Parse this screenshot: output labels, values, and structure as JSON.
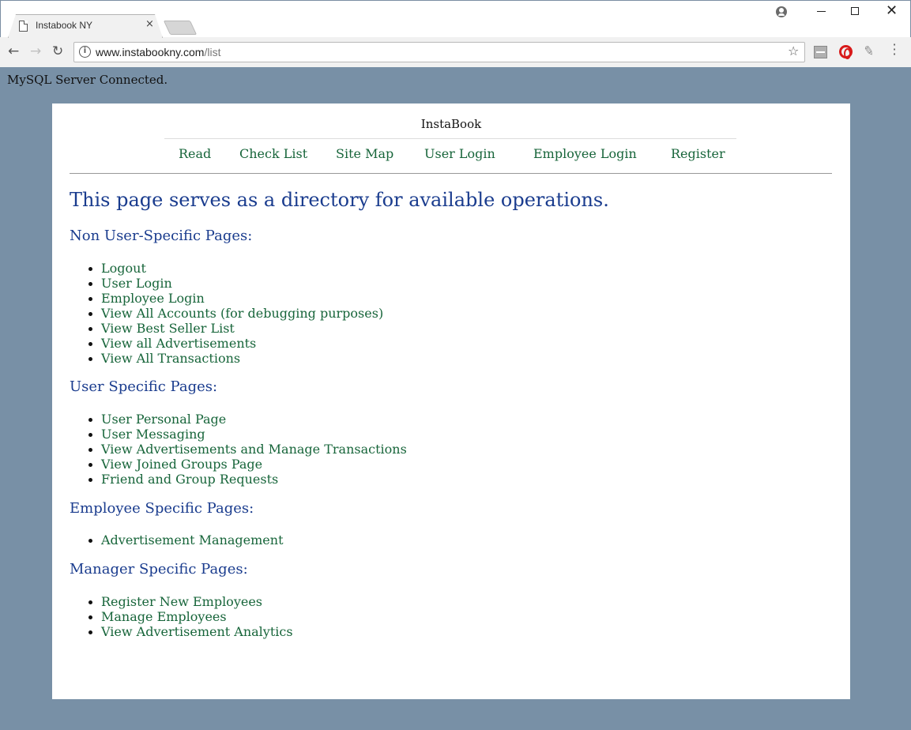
{
  "browser": {
    "tab_title": "Instabook NY",
    "tab_close": "×",
    "url_host": "www.instabookny.com",
    "url_path": "/list",
    "info_glyph": "i",
    "back_glyph": "←",
    "forward_glyph": "→",
    "reload_glyph": "↻",
    "star_glyph": "☆",
    "window_close_glyph": "✕"
  },
  "status_text": "MySQL Server Connected.",
  "site_title": "InstaBook",
  "nav": {
    "read": "Read",
    "check_list": "Check List",
    "site_map": "Site Map",
    "user_login": "User Login",
    "employee_login": "Employee Login",
    "register": "Register"
  },
  "main_heading": "This page serves as a directory for available operations.",
  "sections": [
    {
      "title": "Non User-Specific Pages:",
      "items": [
        "Logout",
        "User Login",
        "Employee Login",
        "View All Accounts (for debugging purposes)",
        "View Best Seller List",
        "View all Advertisements",
        "View All Transactions"
      ]
    },
    {
      "title": "User Specific Pages:",
      "items": [
        "User Personal Page",
        "User Messaging",
        "View Advertisements and Manage Transactions",
        "View Joined Groups Page",
        "Friend and Group Requests"
      ]
    },
    {
      "title": "Employee Specific Pages:",
      "items": [
        "Advertisement Management"
      ]
    },
    {
      "title": "Manager Specific Pages:",
      "items": [
        "Register New Employees",
        "Manage Employees",
        "View Advertisement Analytics"
      ]
    }
  ],
  "colors": {
    "page_background": "#7890a6",
    "link": "#17653a",
    "heading": "#1a3c8e"
  }
}
